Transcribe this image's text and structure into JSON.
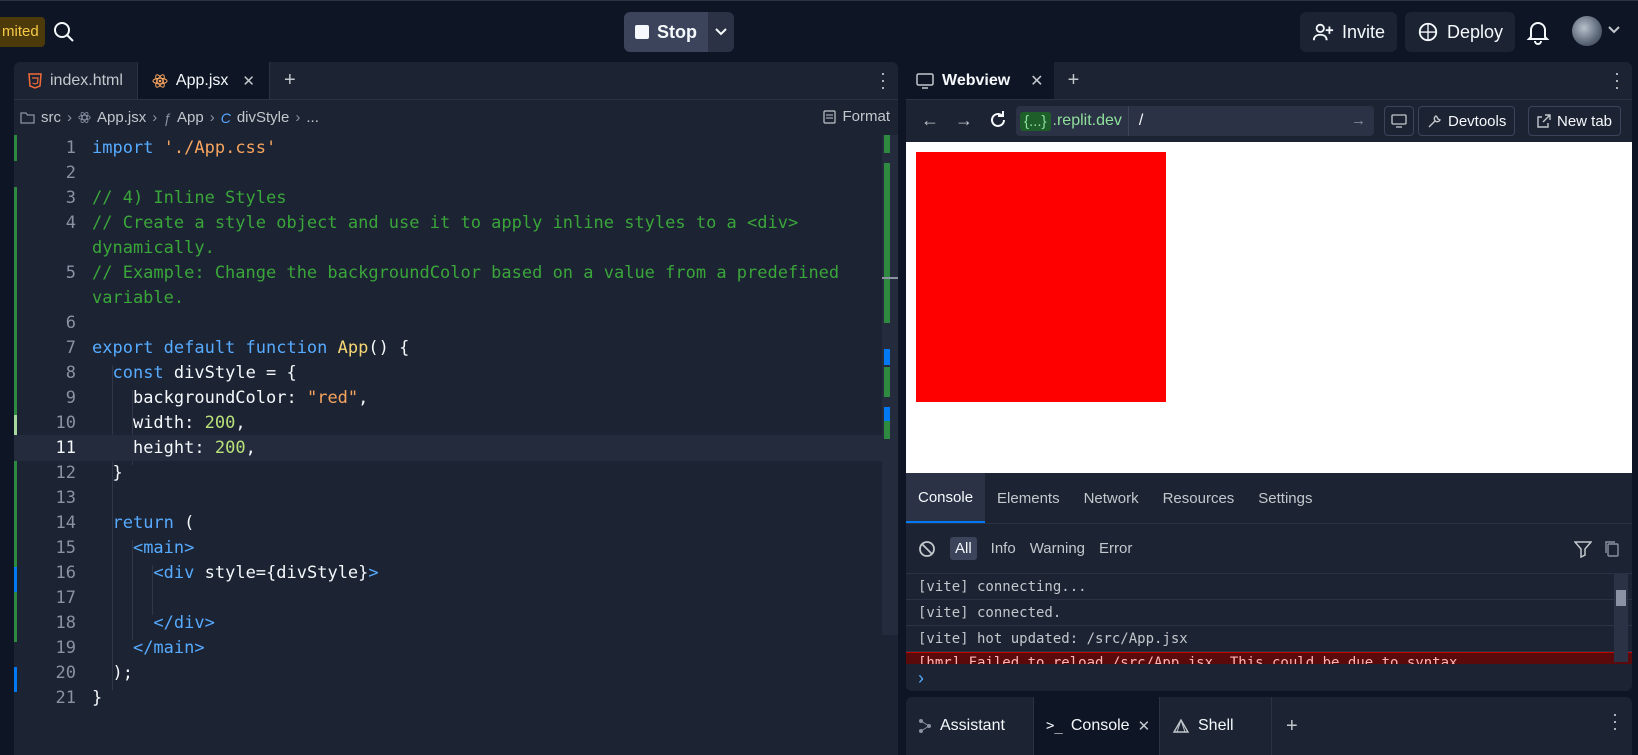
{
  "topbar": {
    "badge": "mited",
    "run_button": "Stop",
    "invite": "Invite",
    "deploy": "Deploy"
  },
  "editor": {
    "tabs": [
      {
        "label": "index.html",
        "icon": "html5-icon"
      },
      {
        "label": "App.jsx",
        "icon": "react-icon",
        "close": "✕"
      }
    ],
    "breadcrumb": [
      "src",
      "App.jsx",
      "App",
      "divStyle",
      "..."
    ],
    "format": "Format",
    "current_line": 11,
    "lines": [
      {
        "n": "1"
      },
      {
        "n": "2"
      },
      {
        "n": "3"
      },
      {
        "n": "4"
      },
      {
        "n": "5"
      },
      {
        "n": "6"
      },
      {
        "n": "7"
      },
      {
        "n": "8"
      },
      {
        "n": "9"
      },
      {
        "n": "10"
      },
      {
        "n": "11"
      },
      {
        "n": "12"
      },
      {
        "n": "13"
      },
      {
        "n": "14"
      },
      {
        "n": "15"
      },
      {
        "n": "16"
      },
      {
        "n": "17"
      },
      {
        "n": "18"
      },
      {
        "n": "19"
      },
      {
        "n": "20"
      },
      {
        "n": "21"
      }
    ],
    "code": {
      "l1_kw": "import",
      "l1_str": "'./App.css'",
      "l3": "// 4) Inline Styles",
      "l4a": "// Create a style object and use it to apply inline styles to a <div>",
      "l4b": "dynamically.",
      "l5a": "// Example: Change the backgroundColor based on a value from a predefined",
      "l5b": "variable.",
      "l7_kw": "export default function",
      "l7_fn": "App",
      "l7_rest": "() {",
      "l8_kw": "const",
      "l8_rest": "divStyle = {",
      "l9_key": "backgroundColor:",
      "l9_str": "\"red\"",
      "l9_end": ",",
      "l10_key": "width:",
      "l10_num": "200",
      "l10_end": ",",
      "l11_key": "height:",
      "l11_num": "200",
      "l11_end": ",",
      "l12": "}",
      "l14_kw": "return",
      "l14_rest": "(",
      "l15": "<main>",
      "l16_tag": "<div",
      "l16_attr": "style=",
      "l16_val": "{divStyle}",
      "l16_close": ">",
      "l18": "</div>",
      "l19": "</main>",
      "l20": ");",
      "l21": "}"
    }
  },
  "webview": {
    "tab": "Webview",
    "url_domain": "{...}",
    "url_suffix": ".replit.dev",
    "url_path": "/",
    "devtools": "Devtools",
    "new_tab": "New tab",
    "dev_tabs": [
      "Console",
      "Elements",
      "Network",
      "Resources",
      "Settings"
    ],
    "filters": [
      "All",
      "Info",
      "Warning",
      "Error"
    ],
    "logs": [
      "[vite] connecting...",
      "[vite] connected.",
      "[vite] hot updated: /src/App.jsx"
    ],
    "error_log": "[hmr] Failed to reload /src/App.jsx. This could be due to syntax"
  },
  "bottom_tabs": [
    {
      "label": "Assistant",
      "icon": "assistant-icon"
    },
    {
      "label": "Console",
      "icon": "terminal-icon",
      "close": "✕"
    },
    {
      "label": "Shell",
      "icon": "shell-icon"
    }
  ],
  "colors": {
    "accent": "#0079f2",
    "preview_box": "#ff0000"
  }
}
